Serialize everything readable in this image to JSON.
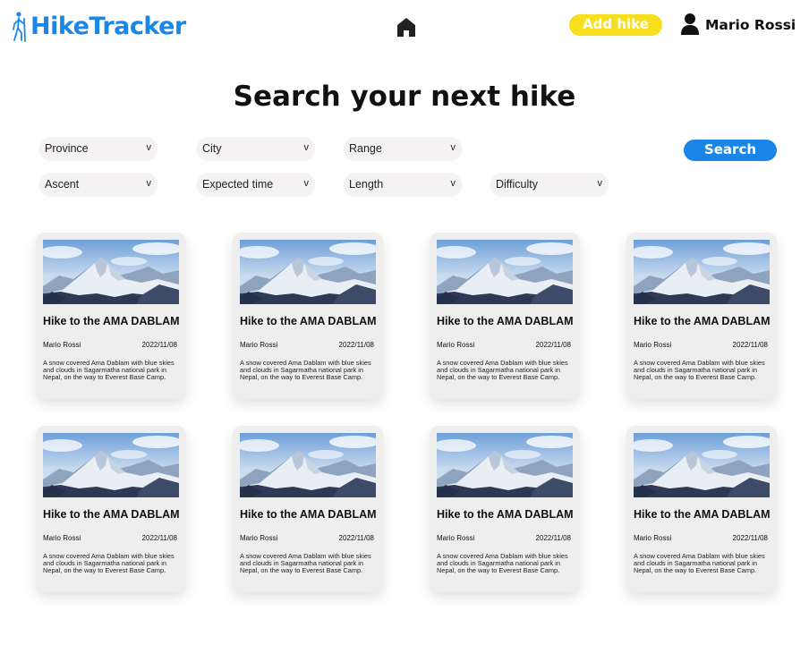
{
  "header": {
    "logo_text": "HikeTracker",
    "home_icon": "home-icon",
    "add_hike_label": "Add hike",
    "user_icon": "user-icon",
    "user_name": "Mario Rossi"
  },
  "page_title": "Search your next hike",
  "filters": {
    "province": "Province",
    "city": "City",
    "range": "Range",
    "ascent": "Ascent",
    "expected_time": "Expected time",
    "length": "Length",
    "difficulty": "Difficulty",
    "chevron": "v"
  },
  "search_label": "Search",
  "colors": {
    "brand_blue": "#1a86e8",
    "add_yellow": "#f7df1e",
    "card_bg": "#efeeee"
  },
  "hikes": [
    {
      "title": "Hike to the AMA DABLAM",
      "author": "Mario Rossi",
      "date": "2022/11/08",
      "description": "A snow covered Ama Dablam with blue skies and clouds in Sagarmatha national park in Nepal, on the way to Everest Base Camp."
    },
    {
      "title": "Hike to the AMA DABLAM",
      "author": "Mario Rossi",
      "date": "2022/11/08",
      "description": "A snow covered Ama Dablam with blue skies and clouds in Sagarmatha national park in Nepal, on the way to Everest Base Camp."
    },
    {
      "title": "Hike to the AMA DABLAM",
      "author": "Mario Rossi",
      "date": "2022/11/08",
      "description": "A snow covered Ama Dablam with blue skies and clouds in Sagarmatha national park in Nepal, on the way to Everest Base Camp."
    },
    {
      "title": "Hike to the AMA DABLAM",
      "author": "Mario Rossi",
      "date": "2022/11/08",
      "description": "A snow covered Ama Dablam with blue skies and clouds in Sagarmatha national park in Nepal, on the way to Everest Base Camp."
    },
    {
      "title": "Hike to the AMA DABLAM",
      "author": "Mario Rossi",
      "date": "2022/11/08",
      "description": "A snow covered Ama Dablam with blue skies and clouds in Sagarmatha national park in Nepal, on the way to Everest Base Camp."
    },
    {
      "title": "Hike to the AMA DABLAM",
      "author": "Mario Rossi",
      "date": "2022/11/08",
      "description": "A snow covered Ama Dablam with blue skies and clouds in Sagarmatha national park in Nepal, on the way to Everest Base Camp."
    },
    {
      "title": "Hike to the AMA DABLAM",
      "author": "Mario Rossi",
      "date": "2022/11/08",
      "description": "A snow covered Ama Dablam with blue skies and clouds in Sagarmatha national park in Nepal, on the way to Everest Base Camp."
    },
    {
      "title": "Hike to the AMA DABLAM",
      "author": "Mario Rossi",
      "date": "2022/11/08",
      "description": "A snow covered Ama Dablam with blue skies and clouds in Sagarmatha national park in Nepal, on the way to Everest Base Camp."
    }
  ]
}
